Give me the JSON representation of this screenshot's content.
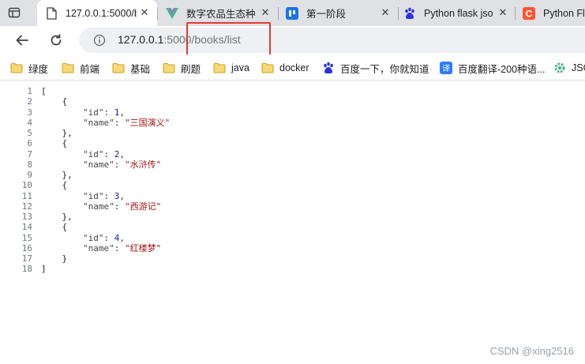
{
  "tabs": [
    {
      "title": "127.0.0.1:5000/b",
      "icon": "page-icon",
      "active": true
    },
    {
      "title": "数字农品生态种",
      "icon": "vue-logo-icon"
    },
    {
      "title": "第一阶段",
      "icon": "blue-app-icon"
    },
    {
      "title": "Python flask jso",
      "icon": "baidu-paw-icon"
    },
    {
      "title": "Python Fla",
      "icon": "csdn-c-icon"
    }
  ],
  "tab_close_glyph": "✕",
  "address": {
    "host": "127.0.0.1",
    "port": ":5000",
    "path": "/books/list"
  },
  "bookmarks": [
    {
      "label": "绿度",
      "icon": "folder-icon"
    },
    {
      "label": "前端",
      "icon": "folder-icon"
    },
    {
      "label": "基础",
      "icon": "folder-icon"
    },
    {
      "label": "刷题",
      "icon": "folder-icon"
    },
    {
      "label": "java",
      "icon": "folder-icon"
    },
    {
      "label": "docker",
      "icon": "folder-icon"
    },
    {
      "label": "百度一下，你就知道",
      "icon": "baidu-paw-icon"
    },
    {
      "label": "百度翻译-200种语...",
      "icon": "baidu-translate-icon"
    },
    {
      "label": "JSO",
      "icon": "gear-icon"
    }
  ],
  "json_lines": [
    {
      "n": "1",
      "text": "["
    },
    {
      "n": "2",
      "text": "    {"
    },
    {
      "n": "3",
      "indent": "        ",
      "key": "\"id\"",
      "sep": ": ",
      "num": "1",
      "tail": ","
    },
    {
      "n": "4",
      "indent": "        ",
      "key": "\"name\"",
      "sep": ": ",
      "str": "\"三国演义\""
    },
    {
      "n": "5",
      "text": "    },"
    },
    {
      "n": "6",
      "text": "    {"
    },
    {
      "n": "7",
      "indent": "        ",
      "key": "\"id\"",
      "sep": ": ",
      "num": "2",
      "tail": ","
    },
    {
      "n": "8",
      "indent": "        ",
      "key": "\"name\"",
      "sep": ": ",
      "str": "\"水浒传\""
    },
    {
      "n": "9",
      "text": "    },"
    },
    {
      "n": "10",
      "text": "    {"
    },
    {
      "n": "11",
      "indent": "        ",
      "key": "\"id\"",
      "sep": ": ",
      "num": "3",
      "tail": ","
    },
    {
      "n": "12",
      "indent": "        ",
      "key": "\"name\"",
      "sep": ": ",
      "str": "\"西游记\""
    },
    {
      "n": "13",
      "text": "    },"
    },
    {
      "n": "14",
      "text": "    {"
    },
    {
      "n": "15",
      "indent": "        ",
      "key": "\"id\"",
      "sep": ": ",
      "num": "4",
      "tail": ","
    },
    {
      "n": "16",
      "indent": "        ",
      "key": "\"name\"",
      "sep": ": ",
      "str": "\"红楼梦\""
    },
    {
      "n": "17",
      "text": "    }"
    },
    {
      "n": "18",
      "text": "]"
    }
  ],
  "watermark": "CSDN @xing2516",
  "colors": {
    "highlight_box": "#e53935",
    "json_number": "#1a1aa6",
    "json_string": "#a31515"
  }
}
